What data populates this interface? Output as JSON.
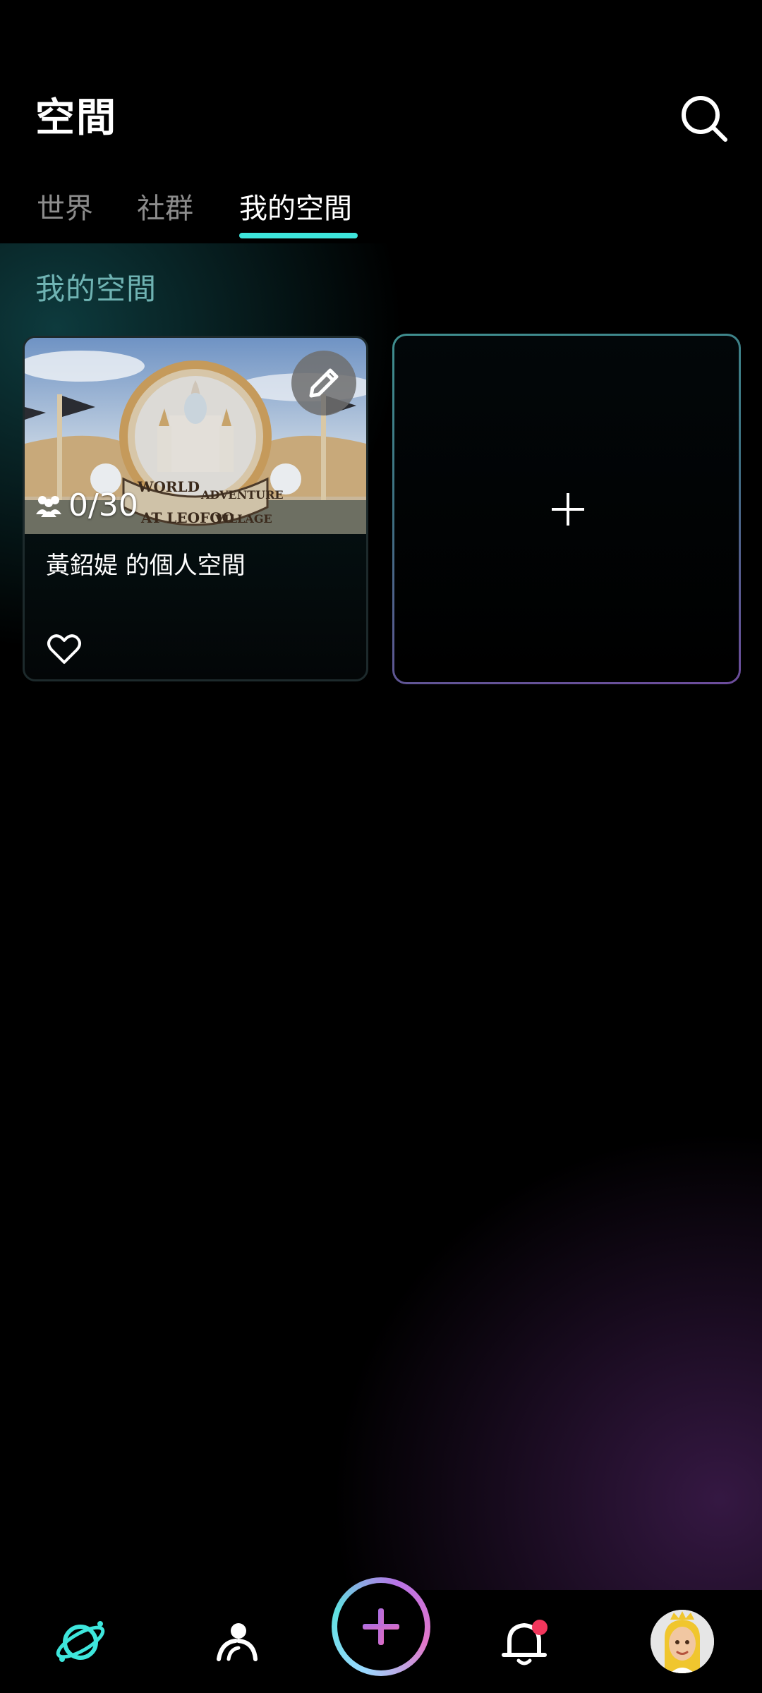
{
  "header": {
    "title": "空間"
  },
  "tabs": [
    {
      "label": "世界",
      "active": false
    },
    {
      "label": "社群",
      "active": false
    },
    {
      "label": "我的空間",
      "active": true
    }
  ],
  "section": {
    "title": "我的空間"
  },
  "space_card": {
    "member_count": "0/30",
    "name": "黃鉊媞 的個人空間",
    "image_text": [
      "WORLD",
      "ADVENTURE",
      "AT LEOFOO",
      "VILLAGE"
    ]
  },
  "colors": {
    "accent": "#3ee6dc",
    "section_title": "#6fb3b3",
    "notification_dot": "#f2365c"
  },
  "icons": {
    "search": "search-icon",
    "edit": "pencil-icon",
    "members": "people-icon",
    "like": "heart-icon",
    "create": "plus-icon",
    "nav_explore": "planet-icon",
    "nav_friends": "people-icon",
    "nav_create": "plus-icon",
    "nav_notifications": "bell-icon",
    "nav_profile": "avatar"
  }
}
